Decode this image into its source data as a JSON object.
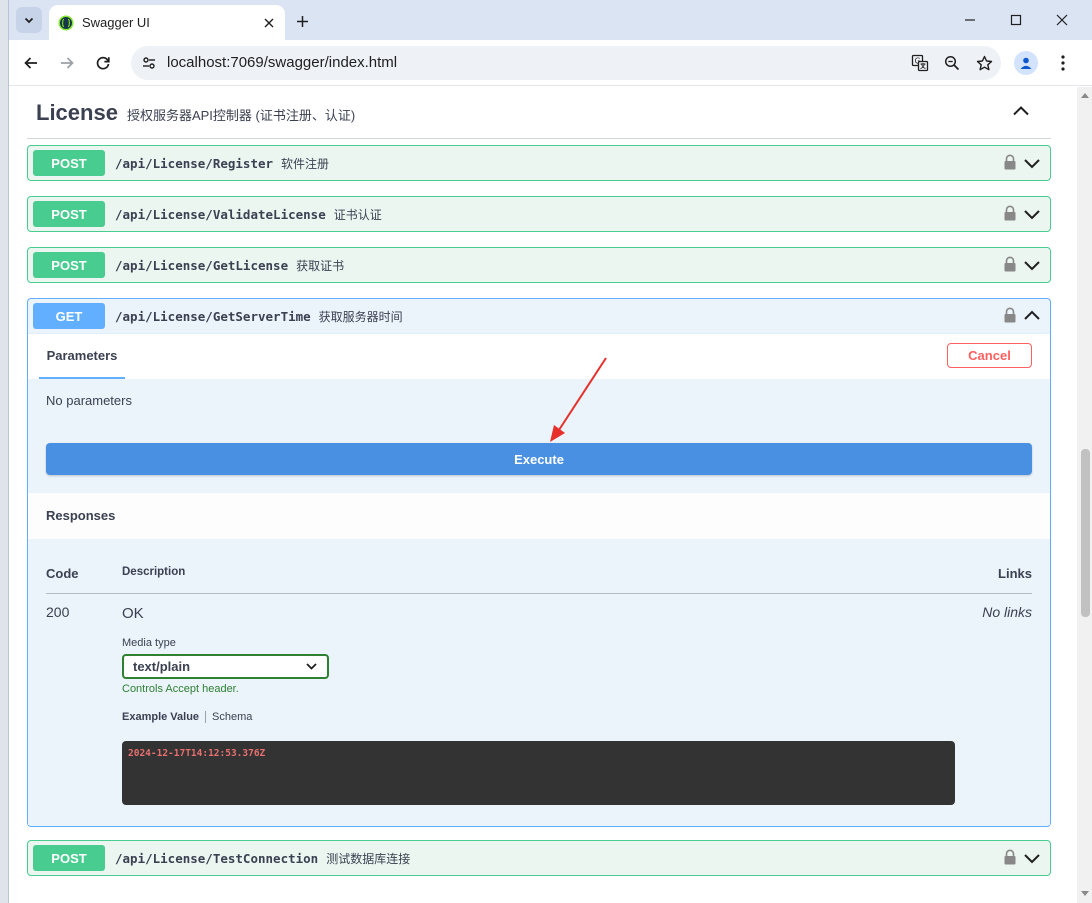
{
  "browser": {
    "tab_title": "Swagger UI",
    "url": "localhost:7069/swagger/index.html"
  },
  "section": {
    "title": "License",
    "description": "授权服务器API控制器 (证书注册、认证)"
  },
  "operations": [
    {
      "method": "POST",
      "path": "/api/License/Register",
      "summary": "软件注册"
    },
    {
      "method": "POST",
      "path": "/api/License/ValidateLicense",
      "summary": "证书认证"
    },
    {
      "method": "POST",
      "path": "/api/License/GetLicense",
      "summary": "获取证书"
    },
    {
      "method": "GET",
      "path": "/api/License/GetServerTime",
      "summary": "获取服务器时间"
    },
    {
      "method": "POST",
      "path": "/api/License/TestConnection",
      "summary": "测试数据库连接"
    }
  ],
  "expanded": {
    "parameters_tab": "Parameters",
    "cancel_label": "Cancel",
    "no_params": "No parameters",
    "execute_label": "Execute",
    "responses_title": "Responses",
    "columns": {
      "code": "Code",
      "description": "Description",
      "links": "Links"
    },
    "response": {
      "code": "200",
      "description": "OK",
      "links": "No links",
      "media_type_label": "Media type",
      "media_type": "text/plain",
      "controls_note": "Controls Accept header.",
      "example_tab": "Example Value",
      "schema_tab": "Schema",
      "example_value": "2024-12-17T14:12:53.376Z"
    }
  },
  "colors": {
    "post": "#49cc90",
    "get": "#61affe",
    "execute": "#4990e2",
    "cancel": "#ff6060",
    "annotation_arrow": "#e8302a"
  }
}
